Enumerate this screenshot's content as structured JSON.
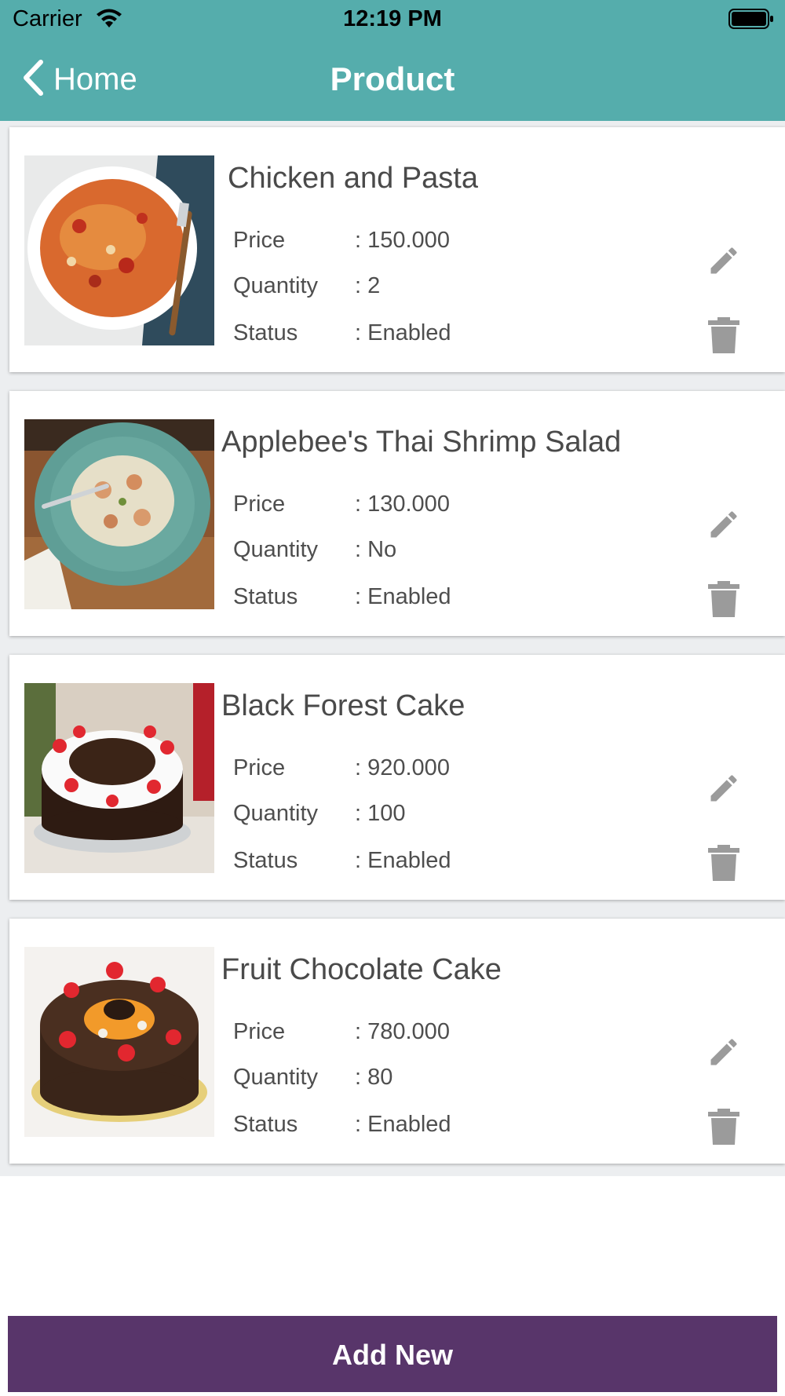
{
  "status_bar": {
    "carrier": "Carrier",
    "time": "12:19 PM"
  },
  "nav": {
    "back_label": "Home",
    "title": "Product"
  },
  "labels": {
    "price": "Price",
    "quantity": "Quantity",
    "status": "Status"
  },
  "products": [
    {
      "name": "Chicken and Pasta",
      "price": ": 150.000",
      "quantity": ": 2",
      "status": ": Enabled"
    },
    {
      "name": "Applebee's Thai Shrimp Salad",
      "price": ": 130.000",
      "quantity": ": No",
      "status": ": Enabled"
    },
    {
      "name": "Black Forest Cake",
      "price": ": 920.000",
      "quantity": ": 100",
      "status": ": Enabled"
    },
    {
      "name": "Fruit Chocolate Cake",
      "price": ": 780.000",
      "quantity": ": 80",
      "status": ": Enabled"
    }
  ],
  "add_button_label": "Add New",
  "icons": [
    "wifi-icon",
    "battery-icon",
    "chevron-left-icon",
    "pencil-icon",
    "trash-icon"
  ],
  "colors": {
    "nav": "#55adac",
    "add_button": "#58356a",
    "icon_gray": "#9b9b9b"
  }
}
